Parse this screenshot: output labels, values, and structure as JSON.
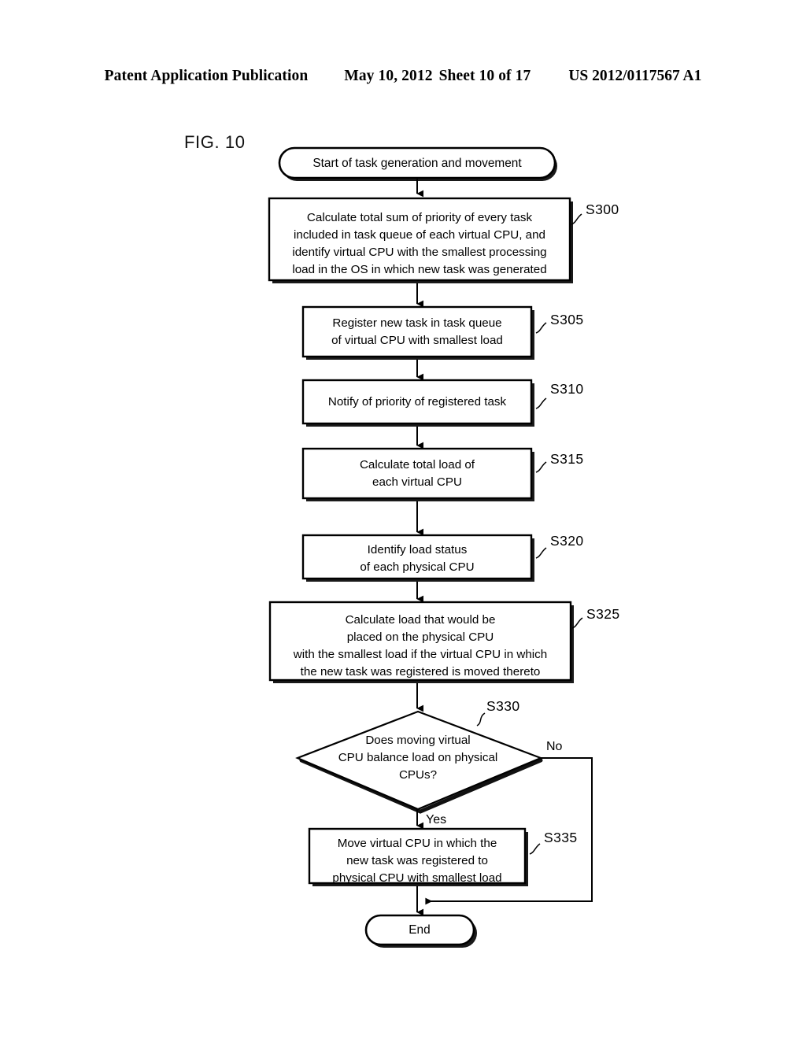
{
  "header": {
    "publication": "Patent Application Publication",
    "date": "May 10, 2012",
    "sheet": "Sheet 10 of 17",
    "number": "US 2012/0117567 A1"
  },
  "figure": {
    "label": "FIG. 10"
  },
  "flowchart": {
    "start": {
      "id": "start-terminator",
      "text": "Start of task generation and movement"
    },
    "steps": [
      {
        "id": "S300",
        "label": "S300",
        "lines": [
          "Calculate total sum of priority of every task",
          "included in task queue of each virtual CPU, and",
          "identify virtual CPU with the smallest processing",
          "load in the OS in which new task was generated"
        ]
      },
      {
        "id": "S305",
        "label": "S305",
        "lines": [
          "Register new task in task queue",
          "of virtual CPU with smallest load"
        ]
      },
      {
        "id": "S310",
        "label": "S310",
        "lines": [
          "Notify of priority of registered task"
        ]
      },
      {
        "id": "S315",
        "label": "S315",
        "lines": [
          "Calculate total load of",
          "each virtual CPU"
        ]
      },
      {
        "id": "S320",
        "label": "S320",
        "lines": [
          "Identify load status",
          "of each physical CPU"
        ]
      },
      {
        "id": "S325",
        "label": "S325",
        "lines": [
          "Calculate load that would be",
          "placed on the physical CPU",
          "with the smallest load if the virtual CPU in which",
          "the new task was registered is moved thereto"
        ]
      }
    ],
    "decision": {
      "id": "S330",
      "label": "S330",
      "lines": [
        "Does moving virtual",
        "CPU balance load on physical",
        "CPUs?"
      ],
      "yes_label": "Yes",
      "no_label": "No"
    },
    "move_step": {
      "id": "S335",
      "label": "S335",
      "lines": [
        "Move virtual CPU in which the",
        "new task was registered to",
        "physical CPU with smallest load"
      ]
    },
    "end": {
      "id": "end-terminator",
      "text": "End"
    }
  },
  "colors": {
    "ink": "#000000",
    "paper": "#ffffff"
  }
}
